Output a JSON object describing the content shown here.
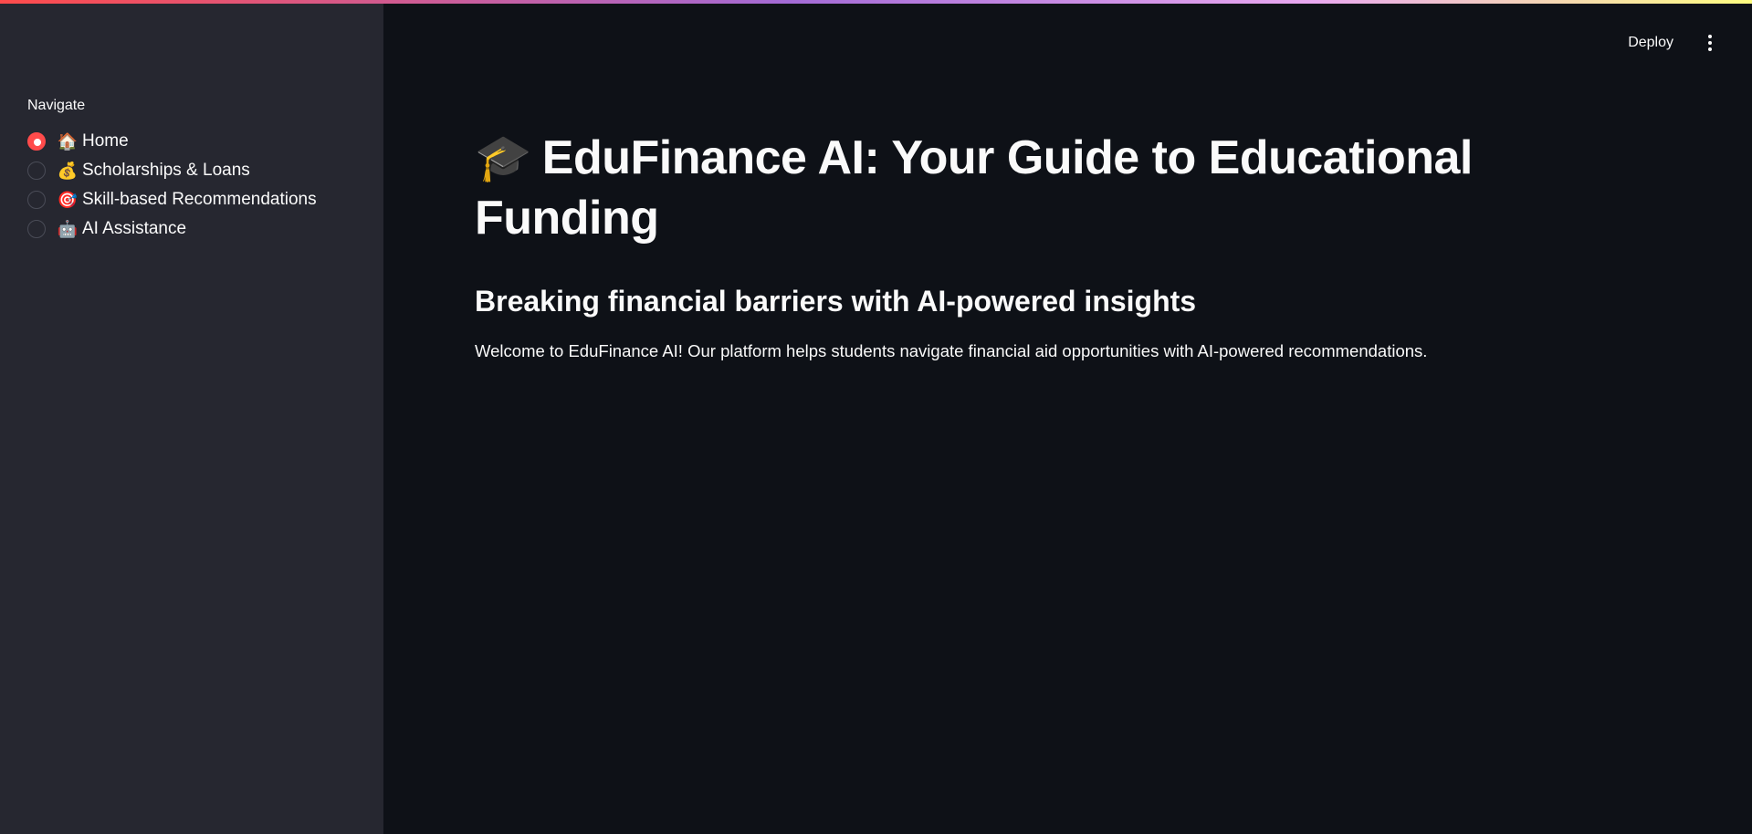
{
  "sidebar": {
    "nav_label": "Navigate",
    "items": [
      {
        "icon": "house-icon",
        "emoji": "🏠",
        "label": "Home",
        "selected": true
      },
      {
        "icon": "money-bag-icon",
        "emoji": "💰",
        "label": "Scholarships & Loans",
        "selected": false
      },
      {
        "icon": "target-icon",
        "emoji": "🎯",
        "label": "Skill-based Recommendations",
        "selected": false
      },
      {
        "icon": "robot-icon",
        "emoji": "🤖",
        "label": "AI Assistance",
        "selected": false
      }
    ]
  },
  "header": {
    "deploy_label": "Deploy",
    "menu_icon": "kebab-menu-icon"
  },
  "main": {
    "title_emoji": "🎓",
    "title_icon": "graduation-cap-icon",
    "title": "EduFinance AI: Your Guide to Educational Funding",
    "subtitle": "Breaking financial barriers with AI-powered insights",
    "intro": "Welcome to EduFinance AI! Our platform helps students navigate financial aid opportunities with AI-powered recommendations."
  },
  "colors": {
    "accent": "#ff4b4b",
    "sidebar_bg": "#262730",
    "main_bg": "#0e1117",
    "text": "#fafafa"
  }
}
